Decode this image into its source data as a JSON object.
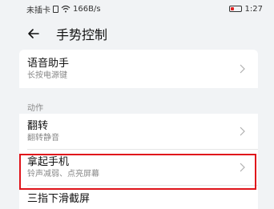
{
  "status_bar": {
    "carrier": "未插卡",
    "speed": "166B/s",
    "time": "1:27"
  },
  "header": {
    "title": "手势控制",
    "back_icon": "arrow-left-icon"
  },
  "voice_assistant": {
    "title": "语音助手",
    "subtitle": "长按电源键"
  },
  "actions_section": {
    "header": "动作",
    "items": [
      {
        "title": "翻转",
        "subtitle": "翻转静音"
      },
      {
        "title": "拿起手机",
        "subtitle": "铃声减弱、点亮屏幕"
      },
      {
        "title": "三指下滑截屏",
        "subtitle": ""
      }
    ]
  },
  "colors": {
    "background": "#f1f3f5",
    "card": "#ffffff",
    "highlight": "#e0141b",
    "subtitle": "#888888"
  }
}
